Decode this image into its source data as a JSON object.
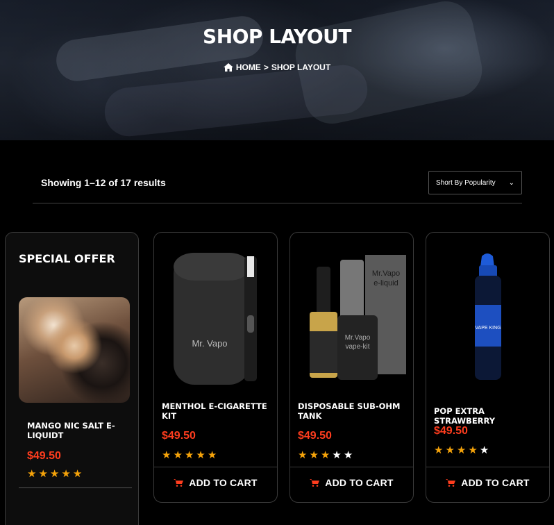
{
  "hero": {
    "title": "SHOP LAYOUT",
    "breadcrumb": {
      "home": "HOME",
      "separator": ">",
      "current": "SHOP LAYOUT"
    }
  },
  "toolbar": {
    "result_count": "Showing 1–12 of 17 results",
    "sort_selected": "Short By Popularity"
  },
  "special_offer": {
    "heading": "SPECIAL OFFER",
    "product": {
      "name": "MANGO NIC SALT E-LIQUIDT",
      "price": "$49.50",
      "rating": 5
    }
  },
  "products": [
    {
      "name": "MENTHOL E-CIGARETTE KIT",
      "price": "$49.50",
      "rating": 5,
      "cart_label": "ADD TO CART",
      "image_icon": "e-cigarette-kit"
    },
    {
      "name": "DISPOSABLE SUB-OHM TANK",
      "price": "$49.50",
      "rating": 3,
      "cart_label": "ADD TO CART",
      "image_icon": "vape-kit-box"
    },
    {
      "name": "POP EXTRA STRAWBERRY",
      "price": "$49.50",
      "rating": 4,
      "cart_label": "ADD TO CART",
      "image_icon": "e-liquid-bottle"
    }
  ],
  "colors": {
    "price": "#ff3d1e",
    "star": "#f5a30a",
    "background": "#000000"
  }
}
